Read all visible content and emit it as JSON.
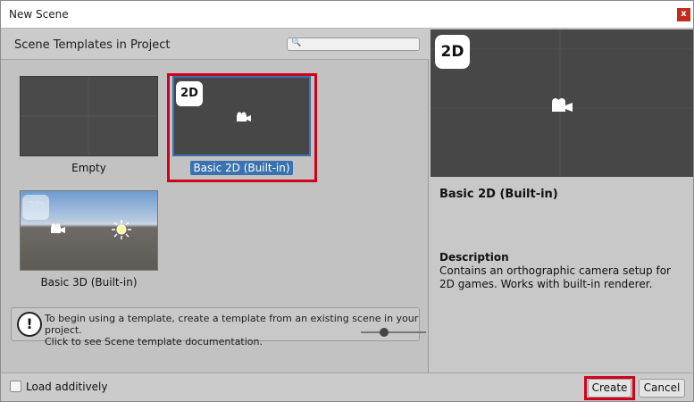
{
  "window": {
    "title": "New Scene",
    "close_label": "x"
  },
  "left_panel": {
    "header": "Scene Templates in Project",
    "search": {
      "icon": "search-icon",
      "value": ""
    },
    "templates": [
      {
        "label": "Empty",
        "badge": "",
        "selected": false
      },
      {
        "label": "Basic 2D (Built-in)",
        "badge": "2D",
        "selected": true
      },
      {
        "label": "Basic 3D (Built-in)",
        "badge": "3D",
        "selected": false
      }
    ],
    "info": {
      "line1": "To begin using a template, create a template from an existing scene in your project.",
      "line2": "Click to see Scene template documentation."
    },
    "zoom_level": 0.35
  },
  "right_panel": {
    "badge": "2D",
    "name": "Basic 2D (Built-in)",
    "description_heading": "Description",
    "description": "Contains an orthographic camera setup for 2D games. Works with built-in renderer."
  },
  "footer": {
    "load_additively_label": "Load additively",
    "load_additively_checked": false,
    "create_label": "Create",
    "cancel_label": "Cancel"
  },
  "colors": {
    "highlight": "#d0021b",
    "selection": "#3a72b0"
  }
}
